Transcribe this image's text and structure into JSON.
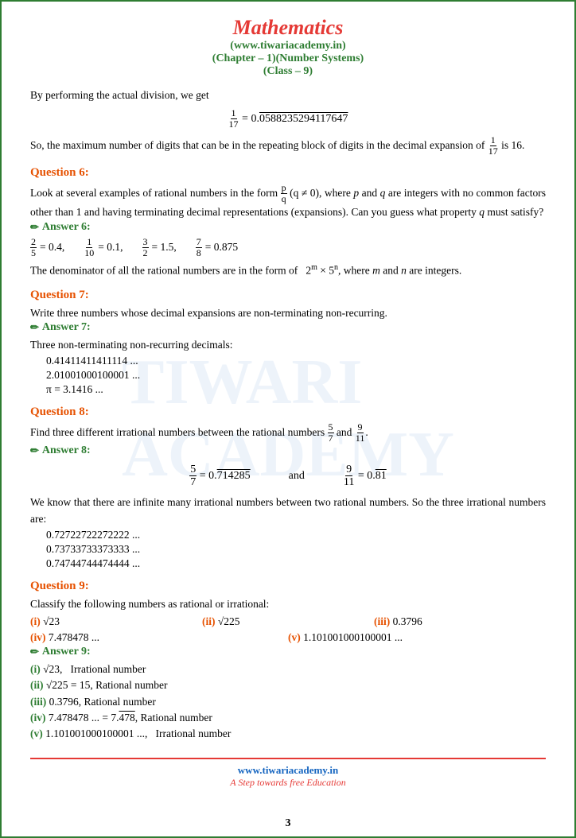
{
  "header": {
    "title": "Mathematics",
    "line2": "(www.tiwariacademy.in)",
    "line3": "(Chapter – 1)(Number Systems)",
    "line4": "(Class – 9)"
  },
  "intro": {
    "text1": "By performing the actual division, we get",
    "equation": "1/17 = 0. 0588235294117647",
    "text2": "So, the maximum number of digits that can be in the repeating block of digits in the decimal expansion of 1/17 is 16."
  },
  "q6": {
    "title": "Question 6:",
    "body": "Look at several examples of rational numbers in the form p/q (q ≠ 0), where p and q are integers with no common factors other than 1 and having terminating decimal representations (expansions). Can you guess what property q must satisfy?",
    "answer_title": "Answer 6:",
    "answer_items": [
      "2/5 = 0.4,",
      "1/10 = 0.1,",
      "3/2 = 1.5,",
      "7/8 = 0.875"
    ],
    "answer_text": "The denominator of all the rational numbers are in the form of  2m × 5n, where m and n are integers."
  },
  "q7": {
    "title": "Question 7:",
    "body": "Write three numbers whose decimal expansions are non-terminating non-recurring.",
    "answer_title": "Answer 7:",
    "answer_intro": "Three non-terminating non-recurring decimals:",
    "items": [
      "0.41411411411114 ...",
      "2.01001000100001 ...",
      "π = 3.1416 ..."
    ]
  },
  "q8": {
    "title": "Question 8:",
    "body": "Find three different irrational numbers between the rational numbers 5/7 and 9/11.",
    "answer_title": "Answer 8:",
    "eq1": "5/7 = 0.714285",
    "and": "and",
    "eq2": "9/11 = 0.81",
    "text": "We know that there are infinite many irrational numbers between two rational numbers. So the three irrational numbers are:",
    "items": [
      "0.72722722272222 ...",
      "0.73733733373333 ...",
      "0.74744744474444 ..."
    ]
  },
  "q9": {
    "title": "Question 9:",
    "body": "Classify the following numbers as rational or irrational:",
    "items_row1": [
      "(i) √23",
      "(ii) √225",
      "(iii) 0.3796"
    ],
    "items_row2": [
      "(iv) 7.478478 ...",
      "(v) 1.101001000100001 ..."
    ],
    "answer_title": "Answer 9:",
    "answers": [
      "(i) √23,  Irrational number",
      "(ii) √225 = 15, Rational number",
      "(iii) 0.3796, Rational number",
      "(iv) 7.478478 ... = 7.478, Rational number",
      "(v) 1.101001000100001 ...,  Irrational number"
    ]
  },
  "footer": {
    "site": "www.tiwariacademy.in",
    "tagline": "A Step towards free Education",
    "page": "3"
  }
}
